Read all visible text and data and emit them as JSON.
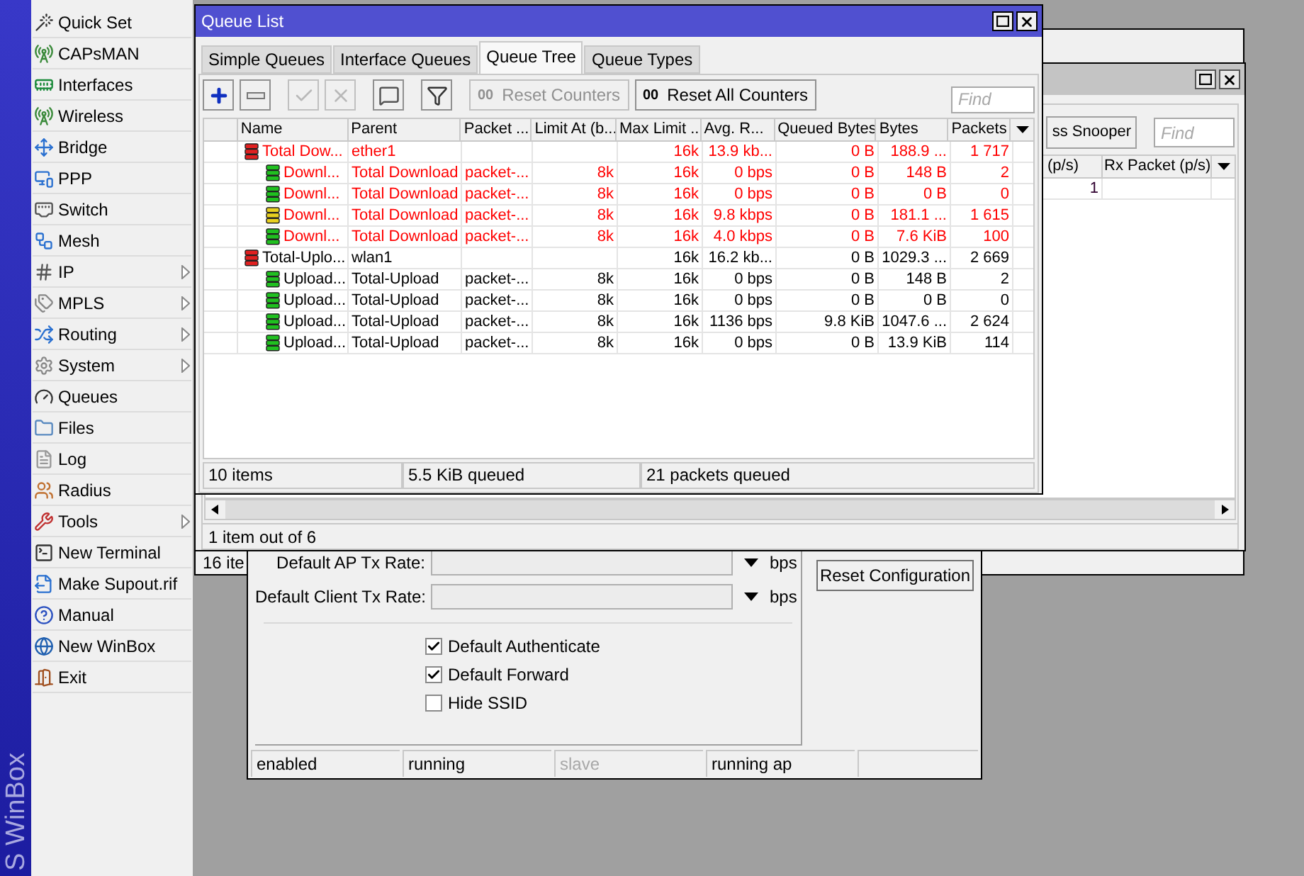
{
  "sidebar": {
    "brand": "S WinBox",
    "items": [
      {
        "label": "Quick Set",
        "submenu": false
      },
      {
        "label": "CAPsMAN",
        "submenu": false
      },
      {
        "label": "Interfaces",
        "submenu": false
      },
      {
        "label": "Wireless",
        "submenu": false
      },
      {
        "label": "Bridge",
        "submenu": false
      },
      {
        "label": "PPP",
        "submenu": false
      },
      {
        "label": "Switch",
        "submenu": false
      },
      {
        "label": "Mesh",
        "submenu": false
      },
      {
        "label": "IP",
        "submenu": true
      },
      {
        "label": "MPLS",
        "submenu": true
      },
      {
        "label": "Routing",
        "submenu": true
      },
      {
        "label": "System",
        "submenu": true
      },
      {
        "label": "Queues",
        "submenu": false
      },
      {
        "label": "Files",
        "submenu": false
      },
      {
        "label": "Log",
        "submenu": false
      },
      {
        "label": "Radius",
        "submenu": false
      },
      {
        "label": "Tools",
        "submenu": true
      },
      {
        "label": "New Terminal",
        "submenu": false
      },
      {
        "label": "Make Supout.rif",
        "submenu": false
      },
      {
        "label": "Manual",
        "submenu": false
      },
      {
        "label": "New WinBox",
        "submenu": false
      },
      {
        "label": "Exit",
        "submenu": false
      }
    ]
  },
  "back_list": {
    "status": "16 ite"
  },
  "wireless": {
    "rate_fields": [
      {
        "label": "Default AP Tx Rate:",
        "unit": "bps"
      },
      {
        "label": "Default Client Tx Rate:",
        "unit": "bps"
      }
    ],
    "checkboxes": [
      {
        "label": "Default Authenticate",
        "checked": true
      },
      {
        "label": "Default Forward",
        "checked": true
      },
      {
        "label": "Hide SSID",
        "checked": false
      }
    ],
    "reset_button": "Reset Configuration",
    "status": [
      {
        "text": "enabled",
        "disabled": false
      },
      {
        "text": "running",
        "disabled": false
      },
      {
        "text": "slave",
        "disabled": true
      },
      {
        "text": "running ap",
        "disabled": false
      }
    ]
  },
  "snooper": {
    "active": false,
    "button": "ss Snooper",
    "find_placeholder": "Find",
    "columns": [
      "(p/s)",
      "Rx Packet (p/s)"
    ],
    "rows": [
      [
        "1",
        ""
      ]
    ],
    "status": "1 item out of 6"
  },
  "queue_list": {
    "title": "Queue List",
    "active": true,
    "tabs": [
      {
        "label": "Simple Queues",
        "selected": false
      },
      {
        "label": "Interface Queues",
        "selected": false
      },
      {
        "label": "Queue Tree",
        "selected": true
      },
      {
        "label": "Queue Types",
        "selected": false
      }
    ],
    "tools": [
      {
        "kind": "add",
        "disabled": false
      },
      {
        "kind": "remove",
        "disabled": false
      },
      {
        "kind": "enable",
        "disabled": true
      },
      {
        "kind": "disable",
        "disabled": true
      },
      {
        "kind": "comment",
        "disabled": false
      },
      {
        "kind": "filter",
        "disabled": false
      }
    ],
    "counter_buttons": [
      {
        "glyph": "00",
        "label": "Reset Counters",
        "disabled": true
      },
      {
        "glyph": "00",
        "label": "Reset All Counters",
        "disabled": false
      }
    ],
    "find_placeholder": "Find",
    "columns": [
      "Name",
      "Parent",
      "Packet ...",
      "Limit At (b...",
      "Max Limit ...",
      "Avg. R...",
      "Queued Bytes",
      "Bytes",
      "Packets"
    ],
    "rows": [
      {
        "name": "Total Dow...",
        "parent": "ether1",
        "packet_marks": "",
        "limit_at": "",
        "max_limit": "16k",
        "avg_rate": "13.9 kb...",
        "queued_bytes": "0 B",
        "bytes": "188.9 ...",
        "packets": "1 717",
        "color": "#e02020",
        "highlighted": true,
        "children": [
          {
            "name": "Downl...",
            "parent": "Total Download",
            "packet_marks": "packet-...",
            "limit_at": "8k",
            "max_limit": "16k",
            "avg_rate": "0 bps",
            "queued_bytes": "0 B",
            "bytes": "148 B",
            "packets": "2",
            "color": "#20c020",
            "highlighted": true
          },
          {
            "name": "Downl...",
            "parent": "Total Download",
            "packet_marks": "packet-...",
            "limit_at": "8k",
            "max_limit": "16k",
            "avg_rate": "0 bps",
            "queued_bytes": "0 B",
            "bytes": "0 B",
            "packets": "0",
            "color": "#20c020",
            "highlighted": true
          },
          {
            "name": "Downl...",
            "parent": "Total Download",
            "packet_marks": "packet-...",
            "limit_at": "8k",
            "max_limit": "16k",
            "avg_rate": "9.8 kbps",
            "queued_bytes": "0 B",
            "bytes": "181.1 ...",
            "packets": "1 615",
            "color": "#e8d020",
            "highlighted": true
          },
          {
            "name": "Downl...",
            "parent": "Total Download",
            "packet_marks": "packet-...",
            "limit_at": "8k",
            "max_limit": "16k",
            "avg_rate": "4.0 kbps",
            "queued_bytes": "0 B",
            "bytes": "7.6 KiB",
            "packets": "100",
            "color": "#20c020",
            "highlighted": true
          }
        ]
      },
      {
        "name": "Total-Uplo...",
        "parent": "wlan1",
        "packet_marks": "",
        "limit_at": "",
        "max_limit": "16k",
        "avg_rate": "16.2 kb...",
        "queued_bytes": "0 B",
        "bytes": "1029.3 ...",
        "packets": "2 669",
        "color": "#e02020",
        "highlighted": false,
        "children": [
          {
            "name": "Upload...",
            "parent": "Total-Upload",
            "packet_marks": "packet-...",
            "limit_at": "8k",
            "max_limit": "16k",
            "avg_rate": "0 bps",
            "queued_bytes": "0 B",
            "bytes": "148 B",
            "packets": "2",
            "color": "#20c020",
            "highlighted": false
          },
          {
            "name": "Upload...",
            "parent": "Total-Upload",
            "packet_marks": "packet-...",
            "limit_at": "8k",
            "max_limit": "16k",
            "avg_rate": "0 bps",
            "queued_bytes": "0 B",
            "bytes": "0 B",
            "packets": "0",
            "color": "#20c020",
            "highlighted": false
          },
          {
            "name": "Upload...",
            "parent": "Total-Upload",
            "packet_marks": "packet-...",
            "limit_at": "8k",
            "max_limit": "16k",
            "avg_rate": "1136 bps",
            "queued_bytes": "9.8 KiB",
            "bytes": "1047.6 ...",
            "packets": "2 624",
            "color": "#20c020",
            "highlighted": false
          },
          {
            "name": "Upload...",
            "parent": "Total-Upload",
            "packet_marks": "packet-...",
            "limit_at": "8k",
            "max_limit": "16k",
            "avg_rate": "0 bps",
            "queued_bytes": "0 B",
            "bytes": "13.9 KiB",
            "packets": "114",
            "color": "#20c020",
            "highlighted": false
          }
        ]
      }
    ],
    "status": [
      "10 items",
      "5.5 KiB queued",
      "21 packets queued"
    ]
  }
}
